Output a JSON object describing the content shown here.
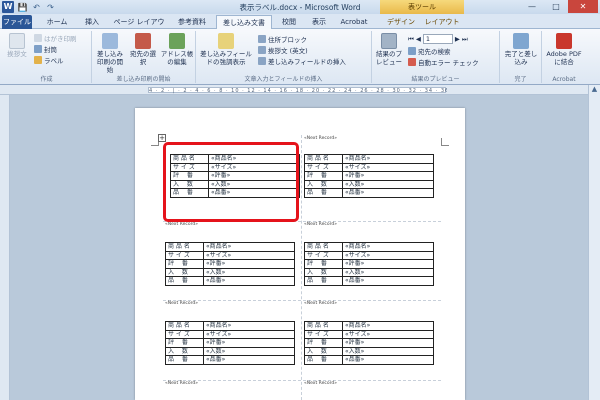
{
  "window": {
    "title": "表示ラベル.docx - Microsoft Word",
    "contextual_header": "表ツール",
    "minimize": "—",
    "maximize": "□",
    "close": "✕",
    "app_icon": "W"
  },
  "qat": [
    "💾",
    "↶",
    "↷"
  ],
  "tabs": [
    "ファイル",
    "ホーム",
    "挿入",
    "ページ レイアウト",
    "参考資料",
    "差し込み文書",
    "校閲",
    "表示",
    "Acrobat",
    "デザイン",
    "レイアウト"
  ],
  "ribbon": {
    "group_create": {
      "label": "作成",
      "envelope": "封筒",
      "label_btn": "ラベル",
      "postcard": "はがき印刷",
      "create_env": "挨拶文"
    },
    "group_start": {
      "label": "差し込み印刷の開始",
      "start": "差し込み印刷の開始",
      "recipients": "宛先の選択",
      "edit": "アドレス帳の編集"
    },
    "group_fields": {
      "label": "文章入力とフィールドの挿入",
      "highlight": "差し込みフィールドの強調表示",
      "address": "住所ブロック",
      "greeting": "挨拶文 (英文)",
      "insert": "差し込みフィールドの挿入"
    },
    "group_preview": {
      "label": "結果のプレビュー",
      "preview": "結果のプレビュー",
      "find": "宛先の検索",
      "check": "自動エラー チェック",
      "record": "1"
    },
    "group_finish": {
      "label": "完了",
      "finish": "完了と差し込み"
    },
    "group_acrobat": {
      "label": "Acrobat",
      "merge": "Adobe PDF に結合"
    }
  },
  "ruler_marks": "4 · 2 · | · 2 · 4 · 6 · 8 · 10 · 12 · 14 · 16 · 18 · 20 · 22 · 24 · 26 · 28 · 30 · 32 · 34 · 36 · 38",
  "next_record": "«Next Record»",
  "label_rows": [
    {
      "key": "商 品 名",
      "value": "«商品名»"
    },
    {
      "key": "サ イ ズ",
      "value": "«サイズ»"
    },
    {
      "key": "評　 番",
      "value": "«評番»"
    },
    {
      "key": "入　 数",
      "value": "«入数»"
    },
    {
      "key": "品　 番",
      "value": "«品番»"
    }
  ],
  "highlight_color": "#e5131b"
}
